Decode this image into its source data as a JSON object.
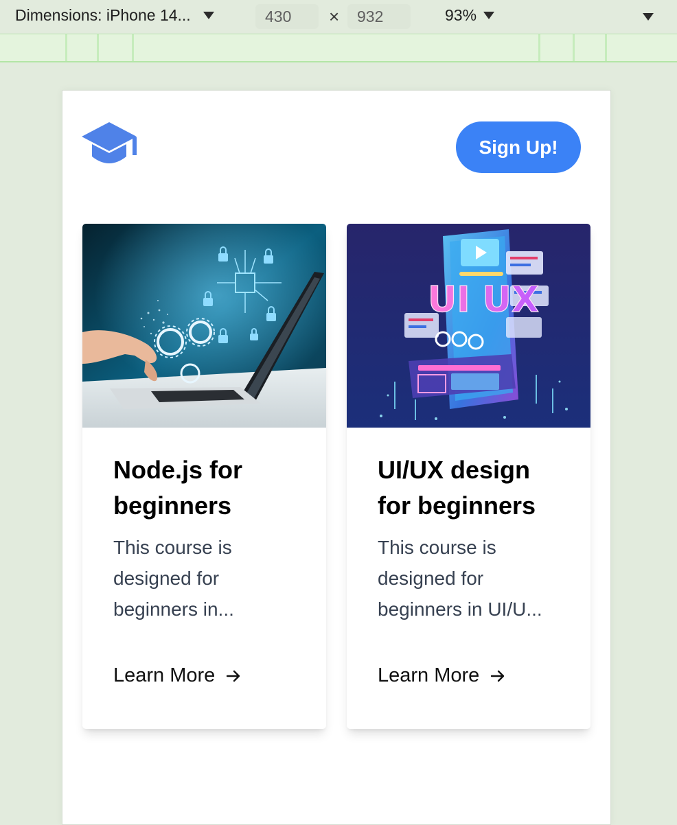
{
  "devtools": {
    "device_label": "Dimensions: iPhone 14...",
    "width_value": "430",
    "times_symbol": "×",
    "height_value": "932",
    "zoom_label": "93%"
  },
  "header": {
    "logo_icon": "graduation-cap-icon",
    "signup_label": "Sign Up!",
    "accent_color": "#3b82f6"
  },
  "courses": [
    {
      "title": "Node.js for beginners",
      "description": "This course is designed for beginners in...",
      "link_label": "Learn More",
      "link_icon": "arrow-right-icon",
      "image": "laptop-cybersecurity-image"
    },
    {
      "title": "UI/UX design for beginners",
      "description": "This course is designed for beginners in UI/U...",
      "link_label": "Learn More",
      "link_icon": "arrow-right-icon",
      "image": "ui-ux-phone-image"
    }
  ]
}
